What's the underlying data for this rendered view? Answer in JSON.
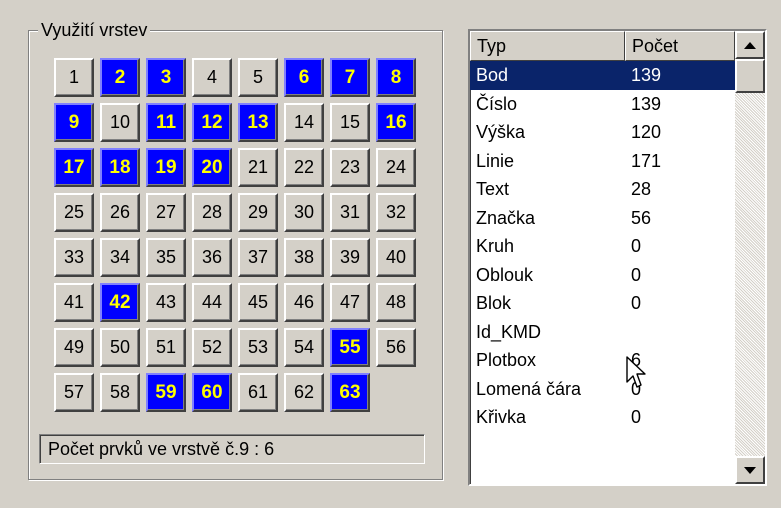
{
  "group": {
    "title": "Využití vrstev"
  },
  "layers": {
    "cells": [
      {
        "n": "1",
        "used": false
      },
      {
        "n": "2",
        "used": true
      },
      {
        "n": "3",
        "used": true
      },
      {
        "n": "4",
        "used": false
      },
      {
        "n": "5",
        "used": false
      },
      {
        "n": "6",
        "used": true
      },
      {
        "n": "7",
        "used": true
      },
      {
        "n": "8",
        "used": true
      },
      {
        "n": "9",
        "used": true
      },
      {
        "n": "10",
        "used": false
      },
      {
        "n": "11",
        "used": true
      },
      {
        "n": "12",
        "used": true
      },
      {
        "n": "13",
        "used": true
      },
      {
        "n": "14",
        "used": false
      },
      {
        "n": "15",
        "used": false
      },
      {
        "n": "16",
        "used": true
      },
      {
        "n": "17",
        "used": true
      },
      {
        "n": "18",
        "used": true
      },
      {
        "n": "19",
        "used": true
      },
      {
        "n": "20",
        "used": true
      },
      {
        "n": "21",
        "used": false
      },
      {
        "n": "22",
        "used": false
      },
      {
        "n": "23",
        "used": false
      },
      {
        "n": "24",
        "used": false
      },
      {
        "n": "25",
        "used": false
      },
      {
        "n": "26",
        "used": false
      },
      {
        "n": "27",
        "used": false
      },
      {
        "n": "28",
        "used": false
      },
      {
        "n": "29",
        "used": false
      },
      {
        "n": "30",
        "used": false
      },
      {
        "n": "31",
        "used": false
      },
      {
        "n": "32",
        "used": false
      },
      {
        "n": "33",
        "used": false
      },
      {
        "n": "34",
        "used": false
      },
      {
        "n": "35",
        "used": false
      },
      {
        "n": "36",
        "used": false
      },
      {
        "n": "37",
        "used": false
      },
      {
        "n": "38",
        "used": false
      },
      {
        "n": "39",
        "used": false
      },
      {
        "n": "40",
        "used": false
      },
      {
        "n": "41",
        "used": false
      },
      {
        "n": "42",
        "used": true
      },
      {
        "n": "43",
        "used": false
      },
      {
        "n": "44",
        "used": false
      },
      {
        "n": "45",
        "used": false
      },
      {
        "n": "46",
        "used": false
      },
      {
        "n": "47",
        "used": false
      },
      {
        "n": "48",
        "used": false
      },
      {
        "n": "49",
        "used": false
      },
      {
        "n": "50",
        "used": false
      },
      {
        "n": "51",
        "used": false
      },
      {
        "n": "52",
        "used": false
      },
      {
        "n": "53",
        "used": false
      },
      {
        "n": "54",
        "used": false
      },
      {
        "n": "55",
        "used": true
      },
      {
        "n": "56",
        "used": false
      },
      {
        "n": "57",
        "used": false
      },
      {
        "n": "58",
        "used": false
      },
      {
        "n": "59",
        "used": true
      },
      {
        "n": "60",
        "used": true
      },
      {
        "n": "61",
        "used": false
      },
      {
        "n": "62",
        "used": false
      },
      {
        "n": "63",
        "used": true
      }
    ]
  },
  "status": {
    "text": "Počet prvků ve vrstvě č.9 : 6"
  },
  "list": {
    "columns": {
      "type": "Typ",
      "count": "Počet"
    },
    "rows": [
      {
        "type": "Bod",
        "count": "139",
        "selected": true
      },
      {
        "type": "Číslo",
        "count": "139"
      },
      {
        "type": "Výška",
        "count": "120"
      },
      {
        "type": "Linie",
        "count": "171"
      },
      {
        "type": "Text",
        "count": "28"
      },
      {
        "type": "Značka",
        "count": "56"
      },
      {
        "type": "Kruh",
        "count": "0"
      },
      {
        "type": "Oblouk",
        "count": "0"
      },
      {
        "type": "Blok",
        "count": "0"
      },
      {
        "type": "Id_KMD",
        "count": ""
      },
      {
        "type": "Plotbox",
        "count": "6"
      },
      {
        "type": "Lomená čára",
        "count": "0"
      },
      {
        "type": "Křivka",
        "count": "0"
      }
    ]
  },
  "colors": {
    "face": "#d4d0c8",
    "used_layer_bg": "#0000ff",
    "used_layer_text": "#ffff00",
    "selection": "#0a246a"
  },
  "icons": {
    "scroll_up": "arrow-up-icon",
    "scroll_down": "arrow-down-icon",
    "pointer": "mouse-cursor-icon"
  }
}
